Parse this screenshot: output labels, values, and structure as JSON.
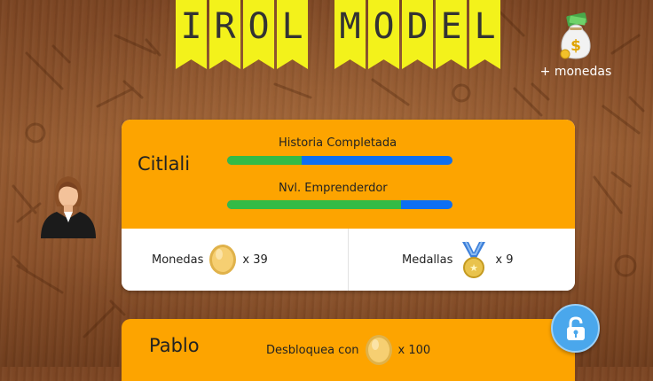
{
  "title": {
    "letters": [
      "I",
      "R",
      "O",
      "L",
      "",
      "M",
      "O",
      "D",
      "E",
      "L"
    ]
  },
  "shop": {
    "label": "+ monedas"
  },
  "profile": {
    "name": "Citlali",
    "history_label": "Historia Completada",
    "history_progress": 0.33,
    "level_label": "Nvl. Emprenderdor",
    "level_progress": 0.77,
    "coins_label": "Monedas",
    "coins_count": "x 39",
    "medals_label": "Medallas",
    "medals_count": "x 9"
  },
  "locked_player": {
    "name": "Pablo",
    "unlock_label": "Desbloquea con",
    "unlock_cost": "x 100"
  },
  "colors": {
    "card_orange": "#fda400",
    "banner_yellow": "#f3f21b",
    "progress_green": "#33bb46",
    "progress_blue": "#0d6ff2",
    "lock_button": "#4aa7ec"
  },
  "icons": {
    "shop": "money-bag-icon",
    "coin": "gold-coin-icon",
    "medal": "medal-icon",
    "lock": "padlock-icon",
    "avatar": "businesswoman-avatar"
  }
}
